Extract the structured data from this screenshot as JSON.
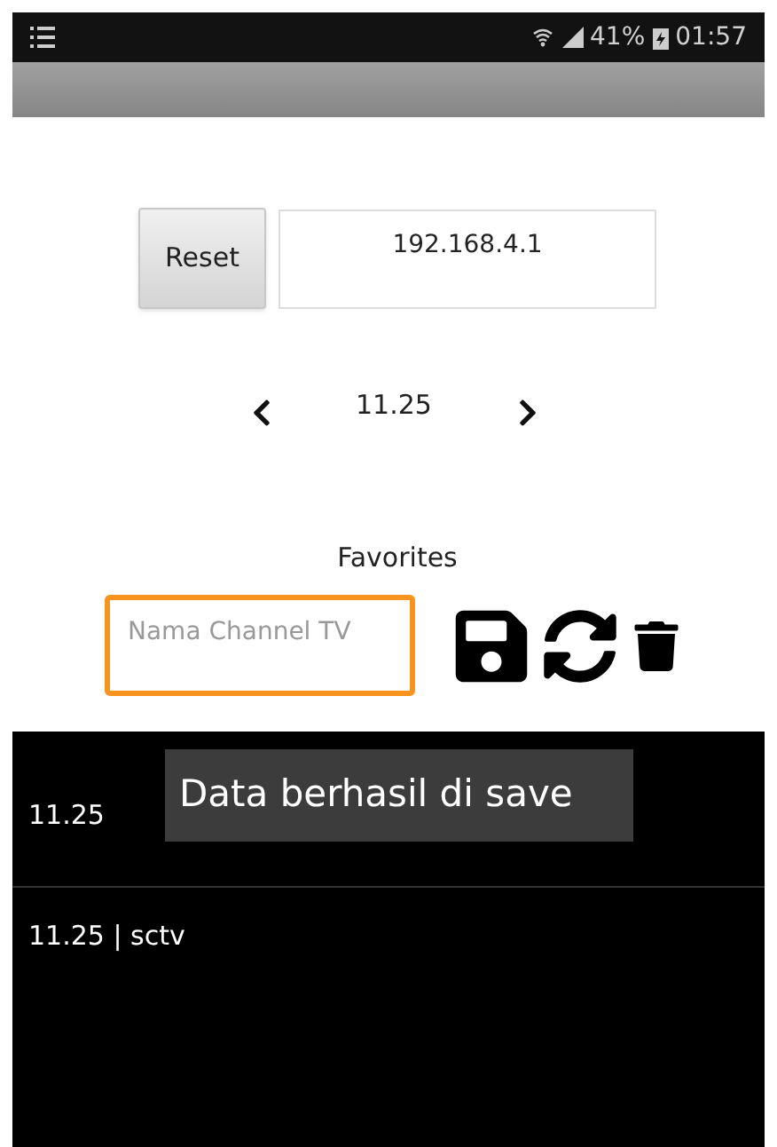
{
  "status_bar": {
    "battery": "41%",
    "time": "01:57"
  },
  "controls": {
    "reset_button": "Reset",
    "ip_field": {
      "value": "192.168.4.1"
    },
    "frequency": "11.25"
  },
  "favorites": {
    "title": "Favorites",
    "name_field": {
      "placeholder": "Nama Channel TV"
    }
  },
  "list": [
    {
      "text": "11.25"
    },
    {
      "text": "11.25 | sctv"
    }
  ],
  "toast": "Data berhasil di save"
}
